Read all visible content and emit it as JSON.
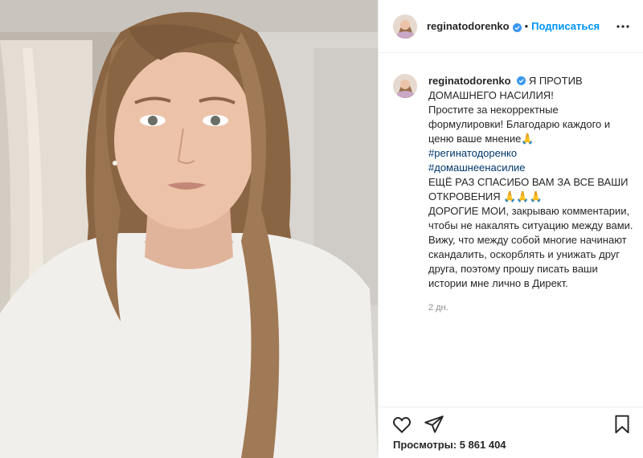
{
  "post": {
    "username": "reginatodorenko",
    "follow_label": "Подписаться",
    "separator": "•",
    "caption": {
      "username": "reginatodorenko",
      "lines": [
        "Я ПРОТИВ ДОМАШНЕГО НАСИЛИЯ!",
        "Простите за некорректные формулировки! Благодарю каждого и ценю ваше мнение🙏",
        "ЕЩЁ РАЗ СПАСИБО ВАМ ЗА ВСЕ ВАШИ ОТКРОВЕНИЯ 🙏🙏🙏",
        "ДОРОГИЕ МОИ, закрываю комментарии, чтобы не накалять ситуацию между вами. Вижу, что между собой многие начинают скандалить, оскорблять и унижать друг друга, поэтому прошу писать ваши истории мне лично в Директ."
      ],
      "hashtags": [
        "#регинатодоренко",
        "#домашнеенасилие"
      ]
    },
    "time_ago": "2 дн.",
    "views": "Просмотры: 5 861 404",
    "icons": {
      "verified": "verified-badge-icon",
      "more": "more-options-icon",
      "like": "heart-icon",
      "share": "share-icon",
      "save": "bookmark-icon"
    },
    "colors": {
      "accent": "#0095f6",
      "hashtag": "#00376b",
      "text": "#262626",
      "muted": "#8e8e8e"
    }
  }
}
